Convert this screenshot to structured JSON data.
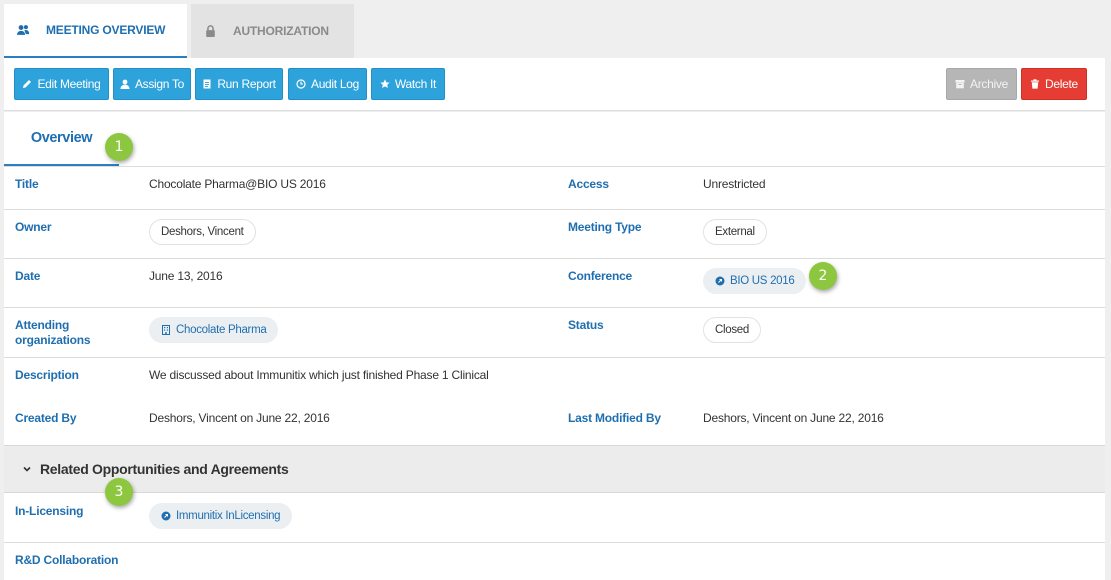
{
  "tabs": [
    {
      "label": "MEETING OVERVIEW",
      "icon": "users-icon",
      "active": true
    },
    {
      "label": "AUTHORIZATION",
      "icon": "lock-icon",
      "active": false
    }
  ],
  "toolbar": {
    "edit": "Edit Meeting",
    "assign": "Assign To",
    "report": "Run Report",
    "audit": "Audit Log",
    "watch": "Watch It",
    "archive": "Archive",
    "delete": "Delete"
  },
  "colors": {
    "accent": "#1f6fb0",
    "button_blue": "#2ea3db",
    "delete_red": "#e53d33",
    "badge_green": "#8dc63f"
  },
  "overview": {
    "tab_label": "Overview",
    "fields": {
      "title_label": "Title",
      "title_value": "Chocolate Pharma@BIO US 2016",
      "access_label": "Access",
      "access_value": "Unrestricted",
      "owner_label": "Owner",
      "owner_value": "Deshors, Vincent",
      "meeting_type_label": "Meeting Type",
      "meeting_type_value": "External",
      "date_label": "Date",
      "date_value": "June 13, 2016",
      "conference_label": "Conference",
      "conference_value": "BIO US 2016",
      "attending_label_1": "Attending",
      "attending_label_2": "organizations",
      "attending_value": "Chocolate Pharma",
      "status_label": "Status",
      "status_value": "Closed",
      "description_label": "Description",
      "description_value": "We discussed about Immunitix which just finished Phase 1 Clinical",
      "created_by_label": "Created By",
      "created_by_value": "Deshors, Vincent on June 22, 2016",
      "last_modified_label": "Last Modified By",
      "last_modified_value": "Deshors, Vincent on June 22, 2016"
    }
  },
  "related": {
    "title": "Related Opportunities and Agreements",
    "in_licensing_label": "In-Licensing",
    "in_licensing_value": "Immunitix InLicensing",
    "rd_label": "R&D Collaboration"
  },
  "badges": [
    "1",
    "2",
    "3"
  ]
}
